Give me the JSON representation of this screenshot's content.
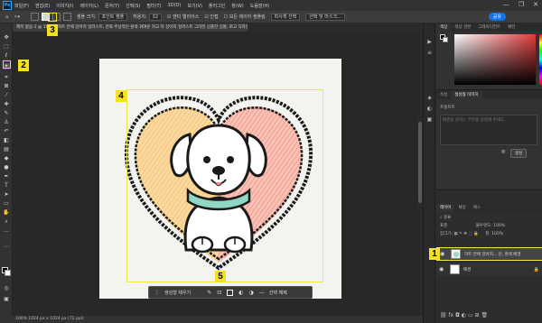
{
  "menubar": {
    "logo": "Ps",
    "items": [
      "파일(F)",
      "편집(E)",
      "이미지(I)",
      "레이어(L)",
      "문자(Y)",
      "선택(S)",
      "필터(T)",
      "3D(D)",
      "보기(V)",
      "플러그인",
      "창(W)",
      "도움말(H)"
    ],
    "win_controls": [
      "—",
      "❐",
      "✕"
    ]
  },
  "options": {
    "sample_label": "샘플 크기:",
    "sample_value": "포인트 샘플",
    "tolerance_label": "허용치:",
    "tolerance_value": "32",
    "anti_alias": "앤티 앨리어스",
    "contiguous": "인접",
    "all_layers": "모든 레이어 샘플링",
    "select_subject": "피사체 선택",
    "select_mask": "선택 및 마스크...",
    "share": "공유"
  },
  "tab": {
    "title": "제목 없음-1 @ 100% (하트 안에 강아지 일러스트, 만화 주상적인 원색 귀여운 하고 자 강아지 일러스트 그려진 심플한 심볼, 로고 디자인, 흰색 배경, RGB/8) *"
  },
  "context_bar": {
    "generate_label": "생성형 채우기",
    "select_subject": "선택 해제"
  },
  "statusbar": {
    "text": "100%    1024 px x 1024 px (72 ppi)"
  },
  "color_panel": {
    "tabs": [
      "색상",
      "색상 견본",
      "그레이디언트",
      "패턴"
    ],
    "accent": "#e03a3a"
  },
  "generate_panel": {
    "tabs": [
      "속성",
      "생성형 이미지"
    ],
    "prompt_label": "프롬프트",
    "prompt_placeholder": "배경을 원하는 부분을 설명해 주세요...",
    "button": "생성"
  },
  "layers_panel": {
    "tabs": [
      "레이어",
      "채널",
      "패스"
    ],
    "kind": "종류",
    "blend": "표준",
    "opacity_label": "불투명도:",
    "opacity": "100%",
    "lock_label": "잠그기:",
    "fill_label": "칠:",
    "fill": "100%",
    "layers": [
      {
        "name": "하트 안에 강아지... 인, 흰색 배경",
        "active": true
      },
      {
        "name": "배경",
        "active": false
      }
    ]
  },
  "callouts": [
    "1",
    "2",
    "3",
    "4",
    "5"
  ]
}
